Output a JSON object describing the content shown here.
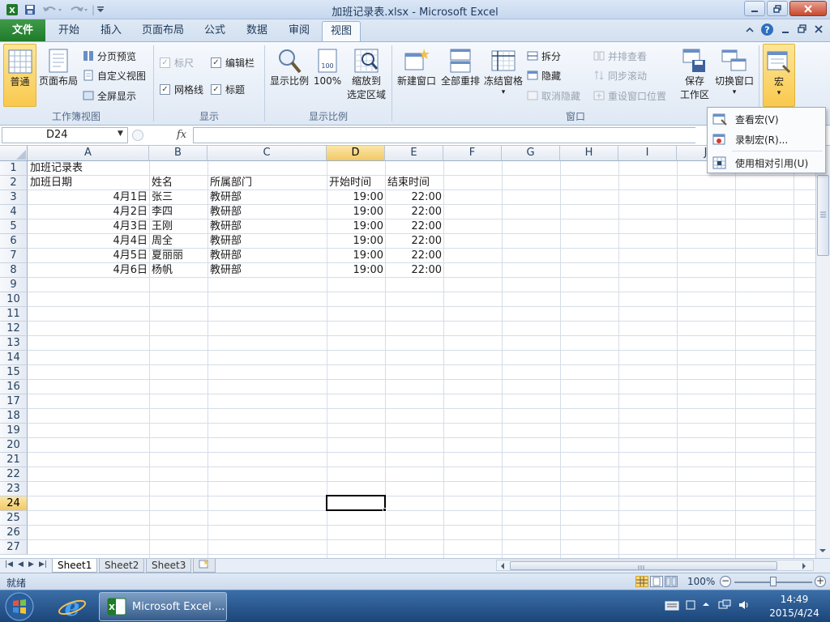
{
  "window": {
    "title": "加班记录表.xlsx - Microsoft Excel",
    "qat_separator": "|"
  },
  "tabs": [
    {
      "label": "文件"
    },
    {
      "label": "开始"
    },
    {
      "label": "插入"
    },
    {
      "label": "页面布局"
    },
    {
      "label": "公式"
    },
    {
      "label": "数据"
    },
    {
      "label": "审阅"
    },
    {
      "label": "视图"
    }
  ],
  "ribbon": {
    "workbook_views": {
      "label": "工作簿视图",
      "normal": "普通",
      "page_layout": "页面布局",
      "page_break_preview": "分页预览",
      "custom_views": "自定义视图",
      "full_screen": "全屏显示"
    },
    "show": {
      "label": "显示",
      "ruler": "标尺",
      "formula_bar": "编辑栏",
      "gridlines": "网格线",
      "headings": "标题"
    },
    "zoom": {
      "label": "显示比例",
      "zoom": "显示比例",
      "zoom_100": "100%",
      "zoom_to_selection_1": "缩放到",
      "zoom_to_selection_2": "选定区域"
    },
    "window": {
      "label": "窗口",
      "new_window": "新建窗口",
      "arrange_all": "全部重排",
      "freeze_panes": "冻结窗格",
      "split": "拆分",
      "hide": "隐藏",
      "unhide": "取消隐藏",
      "view_side_by_side": "并排查看",
      "synchronous_scrolling": "同步滚动",
      "reset_window_position": "重设窗口位置",
      "save_workspace_1": "保存",
      "save_workspace_2": "工作区",
      "switch_windows": "切换窗口"
    },
    "macros": {
      "label": "宏"
    }
  },
  "formula_bar": {
    "name_box": "D24",
    "fx": "fx",
    "formula": ""
  },
  "columns": [
    "A",
    "B",
    "C",
    "D",
    "E",
    "F",
    "G",
    "H",
    "I",
    "J"
  ],
  "rows": [
    "1",
    "2",
    "3",
    "4",
    "5",
    "6",
    "7",
    "8",
    "9",
    "10",
    "11",
    "12",
    "13",
    "14",
    "15",
    "16",
    "17",
    "18",
    "19",
    "20",
    "21",
    "22",
    "23",
    "24",
    "25",
    "26",
    "27"
  ],
  "sheet": {
    "title": "加班记录表",
    "headers": [
      "加班日期",
      "姓名",
      "所属部门",
      "开始时间",
      "结束时间"
    ],
    "data": [
      {
        "date": "4月1日",
        "name": "张三",
        "dept": "教研部",
        "start": "19:00",
        "end": "22:00"
      },
      {
        "date": "4月2日",
        "name": "李四",
        "dept": "教研部",
        "start": "19:00",
        "end": "22:00"
      },
      {
        "date": "4月3日",
        "name": "王刚",
        "dept": "教研部",
        "start": "19:00",
        "end": "22:00"
      },
      {
        "date": "4月4日",
        "name": "周全",
        "dept": "教研部",
        "start": "19:00",
        "end": "22:00"
      },
      {
        "date": "4月5日",
        "name": "夏丽丽",
        "dept": "教研部",
        "start": "19:00",
        "end": "22:00"
      },
      {
        "date": "4月6日",
        "name": "杨帆",
        "dept": "教研部",
        "start": "19:00",
        "end": "22:00"
      }
    ],
    "active_cell": "D24"
  },
  "macro_menu": {
    "view_macros": "查看宏(V)",
    "record_macro": "录制宏(R)...",
    "use_relative_references": "使用相对引用(U)"
  },
  "sheet_tabs": [
    "Sheet1",
    "Sheet2",
    "Sheet3"
  ],
  "status": {
    "text": "就绪",
    "zoom": "100%",
    "zoom_percent": 100
  },
  "taskbar": {
    "excel_label": "Microsoft Excel ...",
    "time": "14:49",
    "date": "2015/4/24"
  },
  "colors": {
    "file_tab": "#1f7a2a",
    "selection_header": "#f2c865",
    "ribbon_bg": "#dfe8f4",
    "taskbar": "#1b4579"
  }
}
